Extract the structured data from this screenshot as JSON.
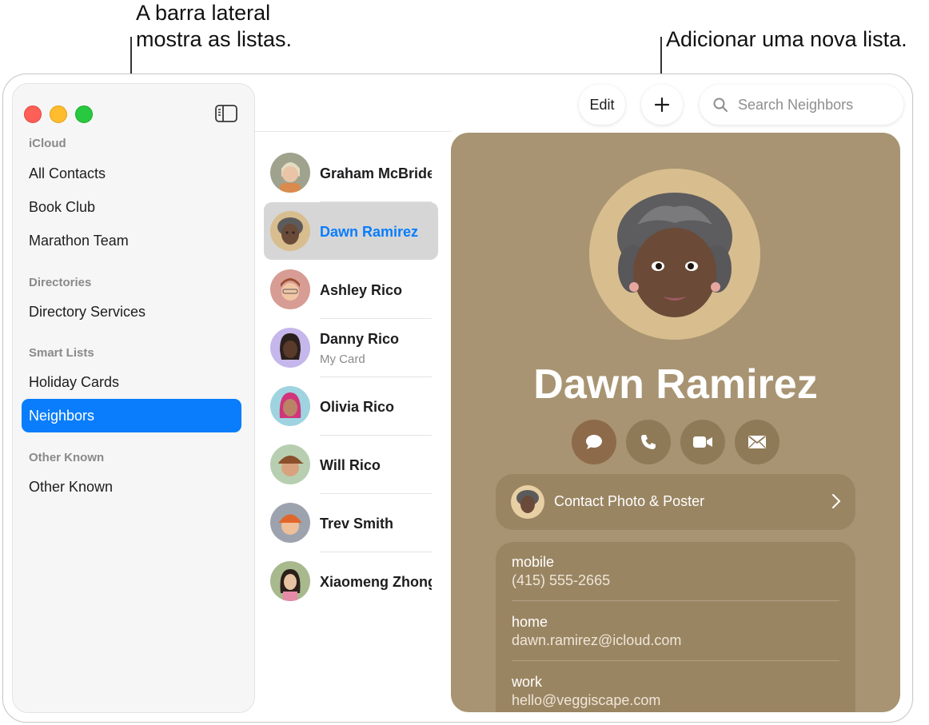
{
  "callouts": {
    "sidebar_line1": "A barra lateral",
    "sidebar_line2": "mostra as listas.",
    "add_list": "Adicionar uma nova lista."
  },
  "sidebar": {
    "sections": [
      {
        "title": "iCloud",
        "items": [
          "All Contacts",
          "Book Club",
          "Marathon Team"
        ]
      },
      {
        "title": "Directories",
        "items": [
          "Directory Services"
        ]
      },
      {
        "title": "Smart Lists",
        "items": [
          "Holiday Cards",
          "Neighbors"
        ]
      },
      {
        "title": "Other Known",
        "items": [
          "Other Known"
        ]
      }
    ],
    "selected": "Neighbors"
  },
  "toolbar": {
    "edit_label": "Edit",
    "search_placeholder": "Search Neighbors"
  },
  "contacts": [
    {
      "name": "Graham McBride",
      "sub": ""
    },
    {
      "name": "Dawn Ramirez",
      "sub": ""
    },
    {
      "name": "Ashley Rico",
      "sub": ""
    },
    {
      "name": "Danny Rico",
      "sub": "My Card"
    },
    {
      "name": "Olivia Rico",
      "sub": ""
    },
    {
      "name": "Will Rico",
      "sub": ""
    },
    {
      "name": "Trev Smith",
      "sub": ""
    },
    {
      "name": "Xiaomeng Zhong",
      "sub": ""
    }
  ],
  "selected_contact": "Dawn Ramirez",
  "detail": {
    "name": "Dawn Ramirez",
    "actions": [
      "message-icon",
      "phone-icon",
      "video-icon",
      "mail-icon"
    ],
    "photo_poster_label": "Contact Photo & Poster",
    "fields": [
      {
        "label": "mobile",
        "value": "(415) 555-2665"
      },
      {
        "label": "home",
        "value": "dawn.ramirez@icloud.com"
      },
      {
        "label": "work",
        "value": "hello@veggiscape.com"
      }
    ]
  },
  "colors": {
    "accent": "#0a7dfc",
    "card_background": "#a89472",
    "close": "#fe5f57",
    "minimize": "#febc2e",
    "zoom": "#28c840"
  }
}
